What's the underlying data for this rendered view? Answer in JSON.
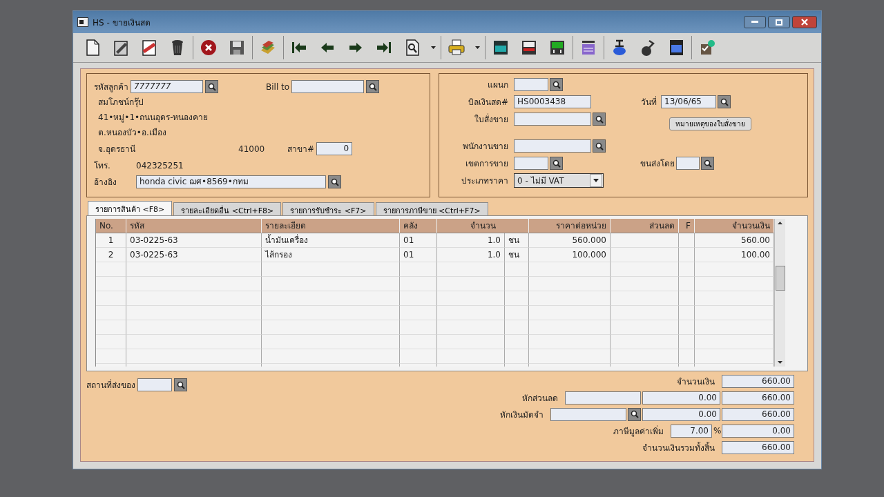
{
  "window": {
    "title": "HS - ขายเงินสด"
  },
  "customer": {
    "code_label": "รหัสลูกค้า",
    "code": "7777777",
    "bill_to_label": "Bill to",
    "name": "สมโภชน์กรุ๊ป",
    "address_1": "41•หมู่•1•ถนนอุดร-หนองคาย",
    "address_2": "ต.หนองบัว•อ.เมือง",
    "province": "จ.อุดรธานี",
    "postcode": "41000",
    "branch_label": "สาขา#",
    "branch": "0",
    "phone_label": "โทร.",
    "phone": "042325251",
    "reference_label": "อ้างอิง",
    "reference": "honda civic ฌศ•8569•กทม"
  },
  "document": {
    "department_label": "แผนก",
    "bill_label": "บิลเงินสด#",
    "bill": "HS0003438",
    "date_label": "วันที่",
    "date": "13/06/65",
    "order_label": "ใบสั่งขาย",
    "order_note_button": "หมายเหตุของใบสั่งขาย",
    "salesperson_label": "พนักงานขาย",
    "area_label": "เขตการขาย",
    "shipping_label": "ขนส่งโดย",
    "price_type_label": "ประเภทราคา",
    "price_type": "0 - ไม่มี VAT"
  },
  "tabs": [
    {
      "label": "รายการสินค้า <F8>",
      "selected": true
    },
    {
      "label": "รายละเอียดอื่น  <Ctrl+F8>",
      "selected": false
    },
    {
      "label": "รายการรับชำระ <F7>",
      "selected": false
    },
    {
      "label": "รายการภาษีขาย <Ctrl+F7>",
      "selected": false
    }
  ],
  "table": {
    "columns": [
      "No.",
      "รหัส",
      "รายละเอียด",
      "คลัง",
      "จำนวน",
      "ราคาต่อหน่วย",
      "ส่วนลด",
      "F",
      "จำนวนเงิน"
    ],
    "rows": [
      {
        "no": "1",
        "code": "03-0225-63",
        "description": "น้ำมันเครื่อง",
        "warehouse": "01",
        "quantity": "1.0",
        "unit": "ชน",
        "unit_price": "560.000",
        "amount": "560.00"
      },
      {
        "no": "2",
        "code": "03-0225-63",
        "description": "ไส้กรอง",
        "warehouse": "01",
        "quantity": "1.0",
        "unit": "ชน",
        "unit_price": "100.000",
        "amount": "100.00"
      }
    ]
  },
  "delivery": {
    "label": "สถานที่ส่งของ"
  },
  "summary": {
    "amount": {
      "label": "จำนวนเงิน",
      "value": "660.00"
    },
    "discount": {
      "label": "หักส่วนลด",
      "value": "0.00",
      "total": "660.00"
    },
    "deposit": {
      "label": "หักเงินมัดจำ",
      "value": "0.00",
      "total": "660.00"
    },
    "vat": {
      "label": "ภาษีมูลค่าเพิ่ม",
      "rate": "7.00",
      "rate_unit": "%",
      "value": "0.00"
    },
    "grand_total": {
      "label": "จำนวนเงินรวมทั้งสิ้น",
      "value": "660.00"
    }
  }
}
